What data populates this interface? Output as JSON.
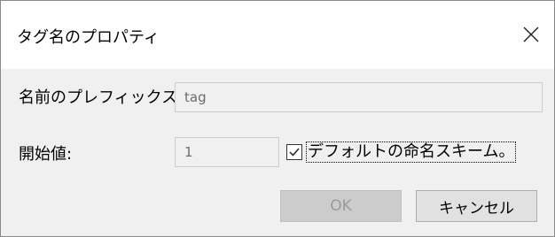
{
  "window": {
    "title": "タグ名のプロパティ"
  },
  "form": {
    "prefix_label": "名前のプレフィックス",
    "prefix_value": "tag",
    "start_label": "開始値:",
    "start_value": "1",
    "default_scheme_label": "デフォルトの命名スキーム。",
    "default_scheme_checked": true
  },
  "buttons": {
    "ok_label": "OK",
    "ok_enabled": false,
    "cancel_label": "キャンセル"
  },
  "icons": {
    "close": "close-icon",
    "check": "checkmark-icon"
  }
}
